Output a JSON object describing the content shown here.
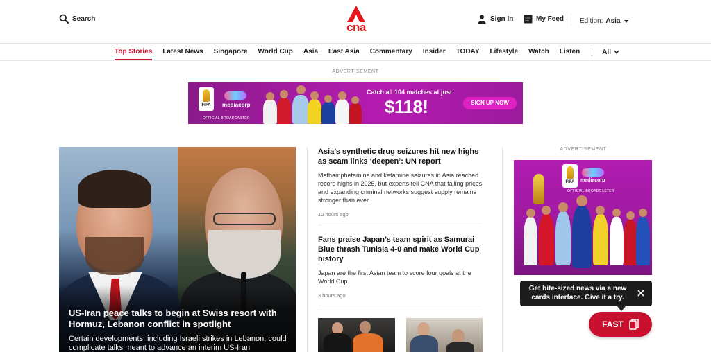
{
  "header": {
    "search_label": "Search",
    "logo_text": "cna",
    "signin_label": "Sign In",
    "myfeed_label": "My Feed",
    "edition_label": "Edition:",
    "edition_value": "Asia"
  },
  "nav": {
    "items": [
      {
        "label": "Top Stories",
        "active": true
      },
      {
        "label": "Latest News"
      },
      {
        "label": "Singapore"
      },
      {
        "label": "World Cup"
      },
      {
        "label": "Asia"
      },
      {
        "label": "East Asia"
      },
      {
        "label": "Commentary"
      },
      {
        "label": "Insider"
      },
      {
        "label": "TODAY"
      },
      {
        "label": "Lifestyle"
      },
      {
        "label": "Watch"
      },
      {
        "label": "Listen"
      }
    ],
    "all_label": "All"
  },
  "ads": {
    "label": "ADVERTISEMENT",
    "banner": {
      "fifa": "FIFA",
      "brand": "mediacorp",
      "official": "OFFICIAL BROADCASTER",
      "tagline": "Catch all 104 matches at just",
      "price": "$118!",
      "cta": "SIGN UP NOW"
    },
    "side": {
      "fifa": "FIFA",
      "brand": "mediacorp",
      "official": "OFFICIAL BROADCASTER"
    }
  },
  "hero": {
    "title": "US-Iran peace talks to begin at Swiss resort with Hormuz, Lebanon conflict in spotlight",
    "description": "Certain developments, including Israeli strikes in Lebanon, could complicate talks meant to advance an interim US-Iran"
  },
  "stories": [
    {
      "title": "Asia’s synthetic drug seizures hit new highs as scam links ‘deepen’: UN report",
      "description": "Methamphetamine and ketamine seizures in Asia reached record highs in 2025, but experts tell CNA that falling prices and expanding criminal networks suggest supply remains stronger than ever.",
      "time": "10 hours ago"
    },
    {
      "title": "Fans praise Japan’s team spirit as Samurai Blue thrash Tunisia 4-0 and make World Cup history",
      "description": "Japan are the first Asian team to score four goals at the World Cup.",
      "time": "3 hours ago"
    }
  ],
  "tooltip": {
    "text": "Get bite-sized news via a new cards interface. Give it a try."
  },
  "fast": {
    "label": "FAST"
  },
  "colors": {
    "brand_red": "#c8102e",
    "ad_magenta": "#a21ca0",
    "tooltip_bg": "#1d1d1d"
  }
}
